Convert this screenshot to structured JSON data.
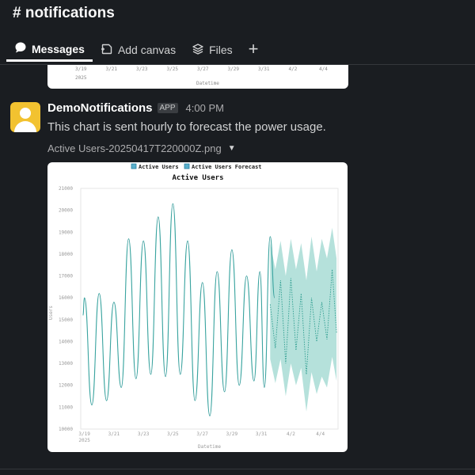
{
  "channel": {
    "title": "# notifications"
  },
  "tabs": [
    {
      "label": "Messages",
      "icon": "message-bubble-icon",
      "active": true
    },
    {
      "label": "Add canvas",
      "icon": "canvas-icon",
      "active": false
    },
    {
      "label": "Files",
      "icon": "files-stack-icon",
      "active": false
    }
  ],
  "previous_chart": {
    "ticks": [
      "3/19",
      "3/21",
      "3/23",
      "3/25",
      "3/27",
      "3/29",
      "3/31",
      "4/2",
      "4/4"
    ],
    "year": "2025",
    "xlabel": "Datetime"
  },
  "message": {
    "sender": "DemoNotifications",
    "badge": "APP",
    "time": "4:00 PM",
    "text": "This chart is sent hourly to forecast the power usage.",
    "file_name": "Active Users-20250417T220000Z.png"
  },
  "colors": {
    "accent": "#3bb5a7",
    "forecast_band": "#a8dcd5",
    "legend_box": "#5ab0cc"
  },
  "chart_data": {
    "type": "line",
    "title": "Active Users",
    "xlabel": "Datetime",
    "ylabel": "Users",
    "year": "2025",
    "legend": [
      "Active Users",
      "Active Users Forecast"
    ],
    "legend_position": "top",
    "x_ticks": [
      "3/19",
      "3/21",
      "3/23",
      "3/25",
      "3/27",
      "3/29",
      "3/31",
      "4/2",
      "4/4"
    ],
    "ylim": [
      10000,
      21000
    ],
    "y_ticks": [
      10000,
      11000,
      12000,
      13000,
      14000,
      15000,
      16000,
      17000,
      18000,
      19000,
      20000,
      21000
    ],
    "xlim": [
      18.75,
      36.2
    ],
    "actual": {
      "name": "Active Users",
      "peaks": [
        [
          19.0,
          16000
        ],
        [
          20.0,
          16200
        ],
        [
          21.0,
          15800
        ],
        [
          22.0,
          18700
        ],
        [
          23.0,
          18600
        ],
        [
          24.0,
          19700
        ],
        [
          25.0,
          20300
        ],
        [
          26.0,
          18600
        ],
        [
          27.0,
          16700
        ],
        [
          28.0,
          17200
        ],
        [
          29.0,
          18200
        ],
        [
          30.0,
          17000
        ],
        [
          30.9,
          17200
        ],
        [
          31.6,
          18800
        ]
      ],
      "troughs": [
        [
          19.5,
          11100
        ],
        [
          20.5,
          11300
        ],
        [
          21.5,
          11900
        ],
        [
          22.5,
          12300
        ],
        [
          23.5,
          12500
        ],
        [
          24.5,
          12400
        ],
        [
          25.5,
          12500
        ],
        [
          26.5,
          11300
        ],
        [
          27.5,
          10600
        ],
        [
          28.5,
          11700
        ],
        [
          29.5,
          12000
        ],
        [
          30.5,
          12200
        ],
        [
          31.2,
          11900
        ]
      ],
      "end": [
        31.9,
        16000
      ]
    },
    "forecast": {
      "name": "Active Users Forecast",
      "x": [
        31.6,
        31.95,
        32.3,
        32.65,
        33.0,
        33.35,
        33.7,
        34.05,
        34.4,
        34.75,
        35.1,
        35.45,
        35.8,
        36.1
      ],
      "mean": [
        15700,
        13700,
        16800,
        13000,
        16900,
        13600,
        16200,
        12500,
        16000,
        14000,
        15800,
        14100,
        17300,
        14400
      ],
      "upper": [
        18500,
        17300,
        18600,
        17000,
        18700,
        17300,
        18500,
        16800,
        18800,
        17200,
        18700,
        17800,
        19200,
        17800
      ],
      "lower": [
        13200,
        12100,
        13200,
        11500,
        13000,
        12000,
        12800,
        10800,
        12600,
        11600,
        12400,
        11900,
        13300,
        12200
      ]
    }
  }
}
